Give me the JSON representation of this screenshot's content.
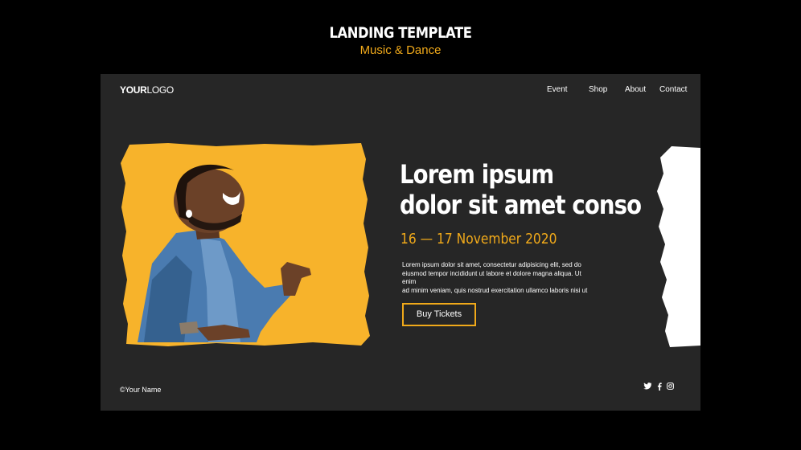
{
  "banner": {
    "title": "LANDING TEMPLATE",
    "subtitle": "Music & Dance"
  },
  "header": {
    "logo_bold": "YOUR",
    "logo_light": "LOGO",
    "nav": [
      "Event",
      "Shop",
      "About",
      "Contact"
    ]
  },
  "hero": {
    "headline_line1": "Lorem ipsum",
    "headline_line2": "dolor sit amet conso",
    "date": "16 — 17 November 2020",
    "body_line1": "Lorem ipsum dolor sit amet, consectetur adipisicing elit, sed do",
    "body_line2": "eiusmod tempor incididunt ut labore et dolore magna aliqua. Ut enim",
    "body_line3": "ad minim veniam, quis nostrud exercitation ullamco laboris nisi ut",
    "cta_label": "Buy Tickets"
  },
  "footer": {
    "copyright": "©Your Name",
    "social_icons": [
      "twitter-icon",
      "facebook-icon",
      "instagram-icon"
    ]
  },
  "colors": {
    "accent": "#f0a91a",
    "card_bg": "#262626",
    "page_bg": "#000000",
    "photo_bg": "#f7b32b"
  }
}
